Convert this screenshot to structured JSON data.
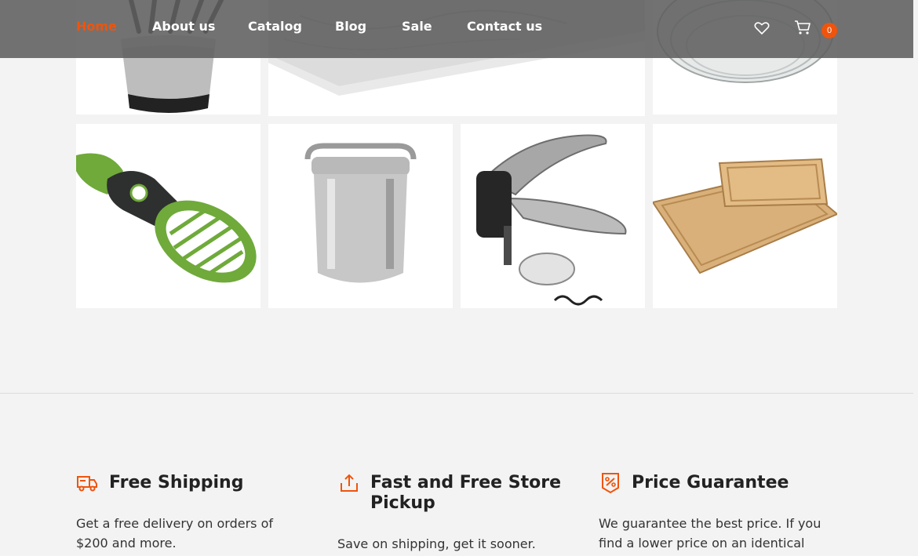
{
  "nav": {
    "items": [
      {
        "label": "Home",
        "active": true
      },
      {
        "label": "About us",
        "active": false
      },
      {
        "label": "Catalog",
        "active": false
      },
      {
        "label": "Blog",
        "active": false
      },
      {
        "label": "Sale",
        "active": false
      },
      {
        "label": "Contact us",
        "active": false
      }
    ],
    "cart_count": "0",
    "icons": [
      "heart-icon",
      "cart-icon"
    ]
  },
  "gallery": {
    "products": [
      "utensil-holder",
      "marble-cutting-board",
      "glass-bowls",
      "avocado-slicer",
      "ice-bucket",
      "corkscrew",
      "wooden-cutting-boards"
    ]
  },
  "features": [
    {
      "icon": "truck-icon",
      "title": "Free Shipping",
      "text": "Get a free delivery on orders of $200 and more."
    },
    {
      "icon": "upload-icon",
      "title": "Fast and Free Store Pickup",
      "text": "Save on shipping, get it sooner. Choose"
    },
    {
      "icon": "price-tag-icon",
      "title": "Price Guarantee",
      "text": "We guarantee the best price. If you find a lower price on an identical name-"
    }
  ],
  "colors": {
    "accent": "#f0540c",
    "navbar": "#5f5f5f",
    "background": "#f3f3f3"
  }
}
